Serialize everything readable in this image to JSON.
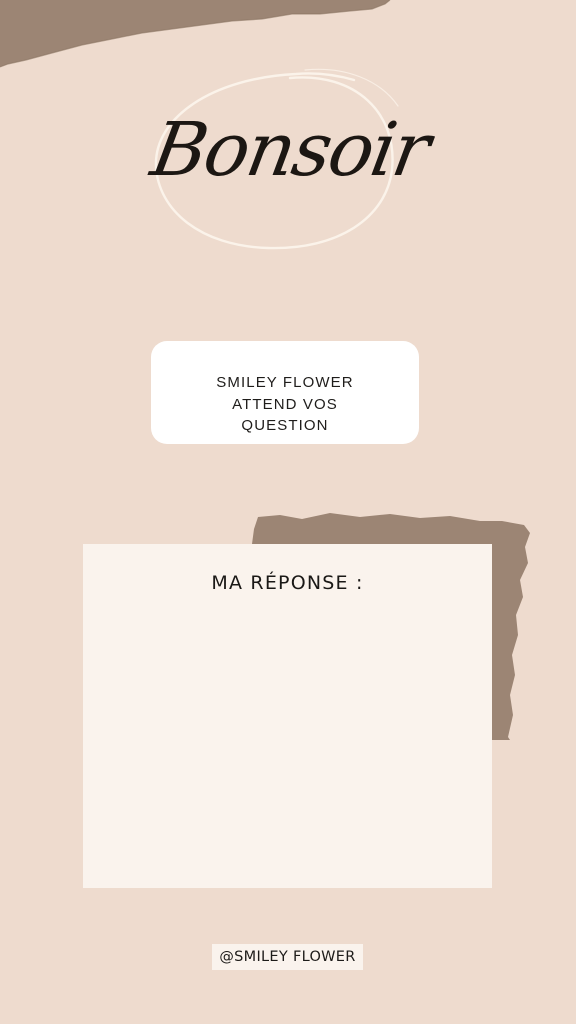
{
  "story": {
    "greeting": "Bonsoir",
    "question_card": {
      "lines": [
        "SMILEY FLOWER",
        "ATTEND VOS",
        "QUESTION"
      ]
    },
    "answer_card": {
      "title": "MA RÉPONSE :"
    },
    "handle": "@SMILEY FLOWER"
  },
  "colors": {
    "background": "#eedbce",
    "torn_paper": "#9c8574",
    "card_white": "#ffffff",
    "card_cream": "#faf3ed",
    "text": "#1c1713"
  }
}
